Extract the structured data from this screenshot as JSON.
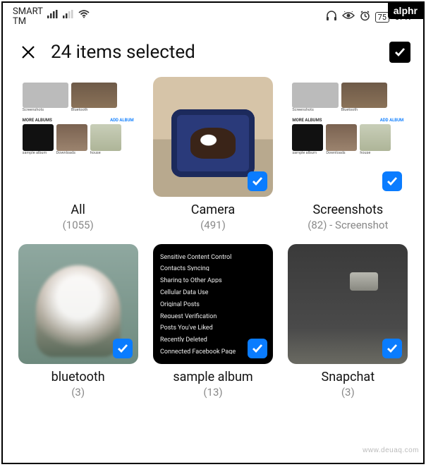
{
  "brand": "alphr",
  "watermark": "www.deuaq.com",
  "status": {
    "carrier": "SMART\nTM",
    "battery": "75",
    "time": "6:47"
  },
  "header": {
    "title": "24 items selected"
  },
  "sample_lines": [
    "Sensitive Content Control",
    "Contacts Syncing",
    "Sharing to Other Apps",
    "Cellular Data Use",
    "Original Posts",
    "Request Verification",
    "Posts You've Liked",
    "Recently Deleted",
    "Connected Facebook Page"
  ],
  "mini_labels": {
    "screenshots": "Screenshots",
    "bluetooth": "Bluetooth",
    "more_albums": "MORE ALBUMS",
    "add_album": "ADD ALBUM",
    "sample_album": "sample album",
    "downloads": "Downloads",
    "house": "house"
  },
  "albums": [
    {
      "name": "All",
      "meta": "(1055)",
      "selected": false
    },
    {
      "name": "Camera",
      "meta": "(491)",
      "selected": true
    },
    {
      "name": "Screenshots",
      "meta": "(82) - Screenshot",
      "selected": true
    },
    {
      "name": "bluetooth",
      "meta": "(3)",
      "selected": true
    },
    {
      "name": "sample album",
      "meta": "(13)",
      "selected": true
    },
    {
      "name": "Snapchat",
      "meta": "(3)",
      "selected": true
    }
  ]
}
